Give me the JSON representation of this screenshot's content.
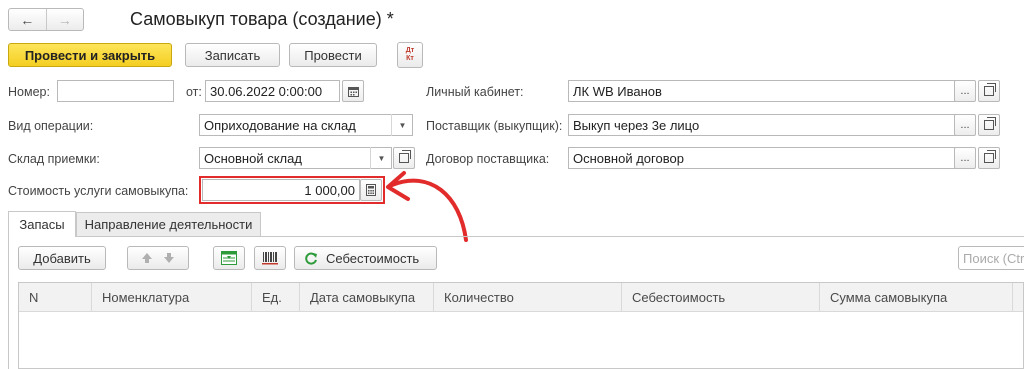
{
  "header": {
    "back": "←",
    "forward": "→",
    "title": "Самовыкуп товара (создание) *"
  },
  "toolbar": {
    "post_close": "Провести и закрыть",
    "save": "Записать",
    "post": "Провести",
    "dtkt_top": "Дт",
    "dtkt_bottom": "Кт"
  },
  "form": {
    "number_label": "Номер:",
    "number_value": "",
    "from_label": "от:",
    "date_value": "30.06.2022  0:00:00",
    "cabinet_label": "Личный кабинет:",
    "cabinet_value": "ЛК WB Иванов",
    "operation_label": "Вид операции:",
    "operation_value": "Оприходование на склад",
    "supplier_label": "Поставщик (выкупщик):",
    "supplier_value": "Выкуп через 3е лицо",
    "warehouse_label": "Склад приемки:",
    "warehouse_value": "Основной склад",
    "contract_label": "Договор поставщика:",
    "contract_value": "Основной договор",
    "cost_label": "Стоимость услуги самовыкупа:",
    "cost_value": "1 000,00"
  },
  "tabs": [
    {
      "label": "Запасы",
      "active": true
    },
    {
      "label": "Направление деятельности",
      "active": false
    }
  ],
  "table_toolbar": {
    "add": "Добавить",
    "cost": "Себестоимость",
    "search_placeholder": "Поиск (Ctrl+F)"
  },
  "table": {
    "columns": [
      "N",
      "Номенклатура",
      "Ед.",
      "Дата самовыкупа",
      "Количество",
      "Себестоимость",
      "Сумма самовыкупа"
    ]
  },
  "colors": {
    "primary_button": "#f4cf22",
    "highlight": "#e22b2b",
    "refresh_icon": "#2e9b3a"
  }
}
